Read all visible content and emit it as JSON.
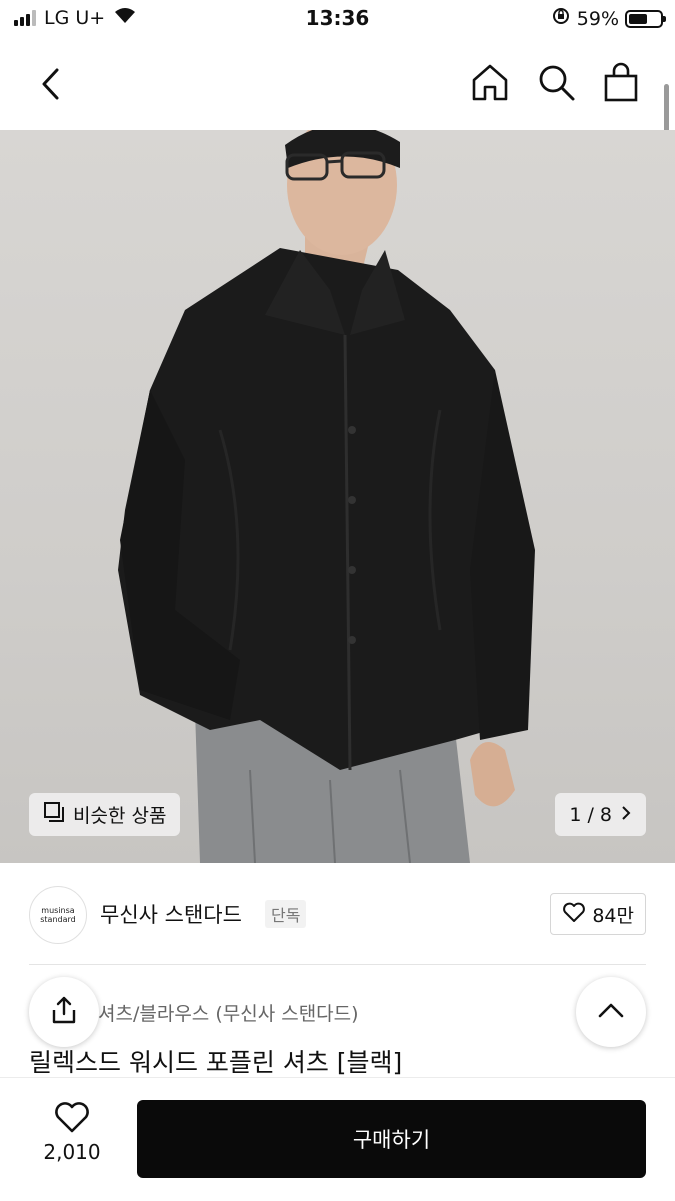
{
  "status_bar": {
    "carrier": "LG U+",
    "time": "13:36",
    "battery_percent": "59%",
    "battery_level": 0.59,
    "signal_bars": 3
  },
  "nav": {
    "icons": [
      "back-chevron-icon",
      "home-icon",
      "search-icon",
      "shopping-bag-icon"
    ]
  },
  "hero": {
    "similar_label": "비슷한 상품",
    "counter": "1 / 8"
  },
  "brand": {
    "logo_line1": "musinsa",
    "logo_line2": "standard",
    "name": "무신사 스탠다드",
    "badge": "단독",
    "likes": "84만"
  },
  "product": {
    "category": "셔츠/블라우스 (무신사 스탠다드)",
    "title": "릴렉스드 워시드 포플린 셔츠 [블랙]"
  },
  "bottom": {
    "wish_count": "2,010",
    "buy_label": "구매하기"
  },
  "colors": {
    "buy_button": "#0a0a0a",
    "hero_background": "#d3d1ce",
    "shirt": "#1b1b1b"
  }
}
